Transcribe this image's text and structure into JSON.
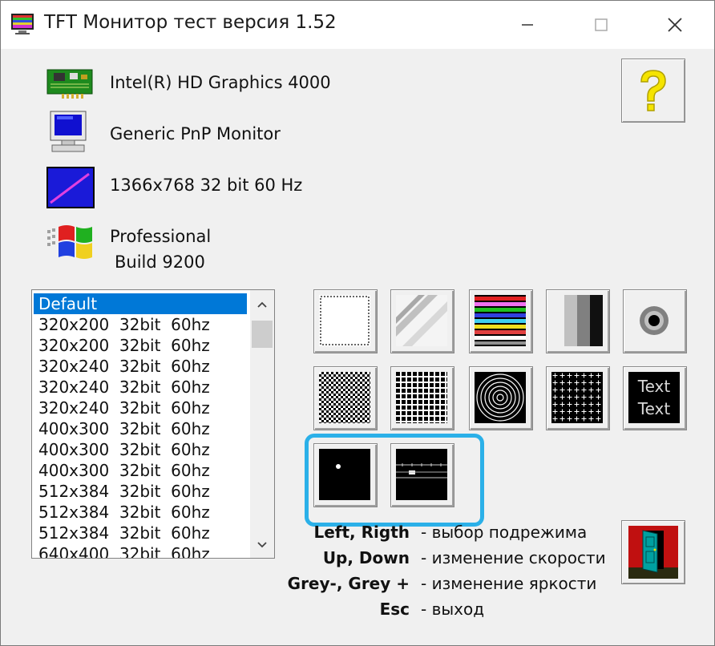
{
  "window": {
    "title": "TFT Монитор тест версия 1.52",
    "minimize_icon": "minimize-icon",
    "maximize_icon": "maximize-icon",
    "close_icon": "close-icon"
  },
  "info": {
    "graphics": "Intel(R) HD Graphics 4000",
    "monitor": "Generic PnP Monitor",
    "mode": "1366x768 32 bit 60 Hz",
    "os_line1": "Professional",
    "os_line2": "Build 9200"
  },
  "modes_list": {
    "items": [
      "Default",
      "320x200  32bit  60hz",
      "320x200  32bit  60hz",
      "320x240  32bit  60hz",
      "320x240  32bit  60hz",
      "320x240  32bit  60hz",
      "400x300  32bit  60hz",
      "400x300  32bit  60hz",
      "400x300  32bit  60hz",
      "512x384  32bit  60hz",
      "512x384  32bit  60hz",
      "512x384  32bit  60hz",
      "640x400  32bit  60hz"
    ],
    "selected_index": 0
  },
  "tests": [
    {
      "icon": "white-frame-test-icon"
    },
    {
      "icon": "gradient-diagonal-test-icon"
    },
    {
      "icon": "color-bars-test-icon"
    },
    {
      "icon": "gray-stripes-test-icon"
    },
    {
      "icon": "circle-target-test-icon"
    },
    {
      "icon": "checkerboard-test-icon"
    },
    {
      "icon": "grid-test-icon"
    },
    {
      "icon": "concentric-circles-test-icon"
    },
    {
      "icon": "crosses-test-icon"
    },
    {
      "icon": "text-test-icon"
    },
    {
      "icon": "moving-dot-test-icon"
    },
    {
      "icon": "moving-bar-test-icon"
    }
  ],
  "text_tile": {
    "line1": "Text",
    "line2": "Text"
  },
  "help": {
    "rows": [
      {
        "key": "Left, Rigth",
        "desc": "- выбор подрежима"
      },
      {
        "key": "Up, Down",
        "desc": "- изменение скорости"
      },
      {
        "key": "Grey-, Grey +",
        "desc": "- изменение яркости"
      },
      {
        "key": "Esc",
        "desc": "- выход"
      }
    ]
  },
  "colors": {
    "highlight": "#2bb0e8",
    "selection": "#0078d7",
    "help_question": "#f5e400",
    "exit_door": "#00a0a0"
  }
}
